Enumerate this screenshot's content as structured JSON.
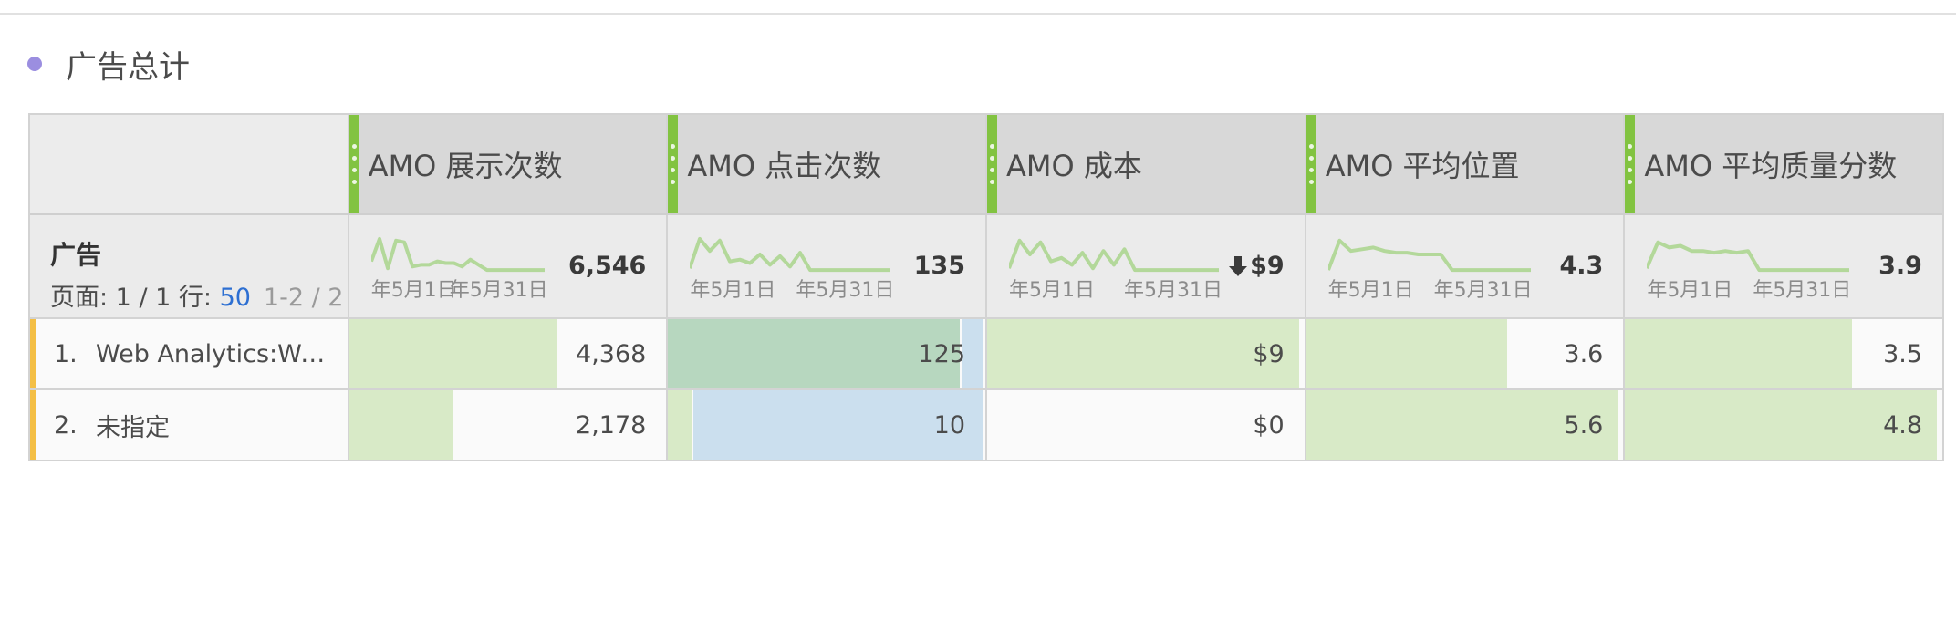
{
  "colors": {
    "title_dot": "#9b8ee0",
    "column_handle": "#82c341",
    "row_marker": "#f4bf45",
    "bar_green": "#d8eac7",
    "bar_teal": "#b7d7bf",
    "bar_blue": "#cbdfee",
    "sparkline": "#b3d89a"
  },
  "panel": {
    "title": "广告总计"
  },
  "table": {
    "dimension": {
      "name": "广告",
      "pager_label": "页面: 1 / 1 行: ",
      "rows_per_page": "50",
      "range": "1-2 / 2"
    },
    "columns": [
      {
        "title": "AMO 展示次数",
        "total": "6,546",
        "trend_down": false,
        "spark_labels": [
          "年5月1日",
          "年5月31日"
        ],
        "spark": [
          0.3,
          0.95,
          0.1,
          0.9,
          0.85,
          0.15,
          0.2,
          0.2,
          0.3,
          0.25,
          0.25,
          0.15,
          0.35,
          0.2,
          0.05,
          0.05,
          0.05,
          0.05,
          0.05,
          0.05,
          0.05,
          0.05
        ]
      },
      {
        "title": "AMO 点击次数",
        "total": "135",
        "trend_down": false,
        "spark_labels": [
          "年5月1日",
          "年5月31日"
        ],
        "spark": [
          0.1,
          0.95,
          0.6,
          0.9,
          0.3,
          0.35,
          0.25,
          0.5,
          0.2,
          0.45,
          0.15,
          0.55,
          0.05,
          0.05,
          0.05,
          0.05,
          0.05,
          0.05,
          0.05,
          0.05,
          0.05
        ]
      },
      {
        "title": "AMO 成本",
        "total": "$9",
        "trend_down": true,
        "spark_labels": [
          "年5月1日",
          "年5月31日"
        ],
        "spark": [
          0.1,
          0.9,
          0.5,
          0.85,
          0.3,
          0.4,
          0.2,
          0.55,
          0.1,
          0.6,
          0.2,
          0.65,
          0.05,
          0.05,
          0.05,
          0.05,
          0.05,
          0.05,
          0.05,
          0.05,
          0.05
        ]
      },
      {
        "title": "AMO 平均位置",
        "total": "4.3",
        "trend_down": false,
        "spark_labels": [
          "年5月1日",
          "年5月31日"
        ],
        "spark": [
          0.05,
          0.9,
          0.6,
          0.65,
          0.7,
          0.6,
          0.55,
          0.55,
          0.5,
          0.5,
          0.5,
          0.05,
          0.05,
          0.05,
          0.05,
          0.05,
          0.05,
          0.05,
          0.05
        ]
      },
      {
        "title": "AMO 平均质量分数",
        "total": "3.9",
        "trend_down": false,
        "spark_labels": [
          "年5月1日",
          "年5月31日"
        ],
        "spark": [
          0.1,
          0.85,
          0.7,
          0.75,
          0.6,
          0.6,
          0.55,
          0.6,
          0.55,
          0.6,
          0.05,
          0.05,
          0.05,
          0.05,
          0.05,
          0.05,
          0.05,
          0.05,
          0.05
        ]
      }
    ],
    "rows": [
      {
        "num": "1.",
        "label": "Web Analytics:Web...",
        "values": [
          "4,368",
          "125",
          "$9",
          "3.6",
          "3.5"
        ],
        "fractions": [
          0.667,
          0.926,
          1.0,
          0.643,
          0.729
        ]
      },
      {
        "num": "2.",
        "label": "未指定",
        "values": [
          "2,178",
          "10",
          "$0",
          "5.6",
          "4.8"
        ],
        "fractions": [
          0.333,
          0.074,
          0.0,
          1.0,
          1.0
        ]
      }
    ]
  }
}
